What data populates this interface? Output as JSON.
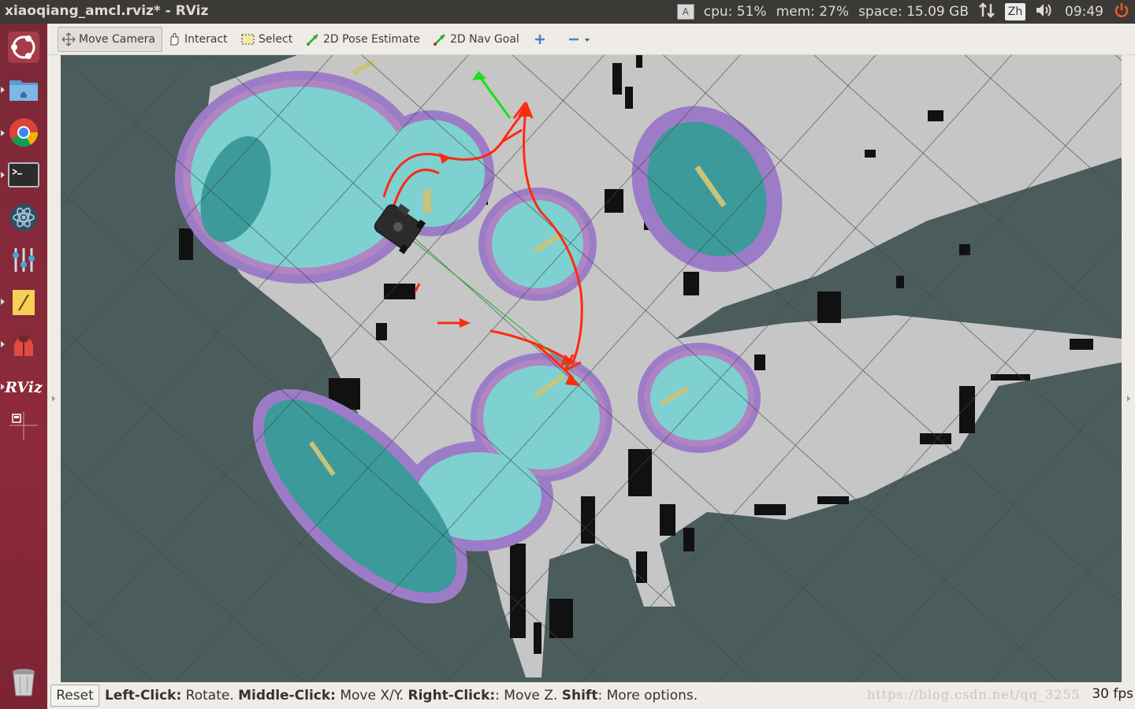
{
  "window": {
    "title": "xiaoqiang_amcl.rviz* - RViz"
  },
  "indicators": {
    "keyboard": "A",
    "cpu": "cpu: 51%",
    "mem": "mem: 27%",
    "space": "space: 15.09 GB",
    "input_method": "Zh",
    "clock": "09:49"
  },
  "launcher": {
    "items": [
      "ubuntu-dash-icon",
      "files-icon",
      "chrome-icon",
      "terminal-icon",
      "atom-icon",
      "settings-icon",
      "notes-icon",
      "bug-icon",
      "rviz-icon",
      "workspace-icon",
      "trash-icon"
    ],
    "rviz_label": "RViz"
  },
  "toolbar": {
    "move_camera": "Move Camera",
    "interact": "Interact",
    "select": "Select",
    "pose_estimate": "2D Pose Estimate",
    "nav_goal": "2D Nav Goal"
  },
  "status": {
    "reset": "Reset",
    "help_parts": [
      {
        "b": "Left-Click:",
        "t": " Rotate. "
      },
      {
        "b": "Middle-Click:",
        "t": " Move X/Y. "
      },
      {
        "b": "Right-Click:",
        "t": ": Move Z. "
      },
      {
        "b": "Shift",
        "t": ": More options."
      }
    ],
    "watermark": "https://blog.csdn.net/qq_3255",
    "fps": "30 fps"
  },
  "colors": {
    "panel": "#3b3a36",
    "launcher": "#8d2a3a",
    "grid_bg": "#4a5a5a",
    "free_space": "#c4c4c4",
    "costmap_inner": "#7fcfcf",
    "costmap_ring": "#9a7cc4",
    "path": "#ff2a10",
    "goal_arrow": "#19e019"
  }
}
